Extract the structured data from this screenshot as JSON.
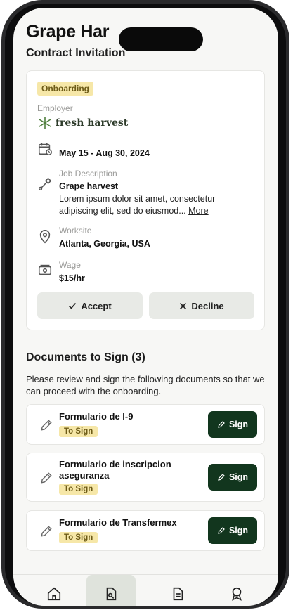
{
  "header": {
    "title": "Grape Har",
    "subtitle": "Contract Invitation"
  },
  "contract": {
    "status": "Onboarding",
    "employer_label": "Employer",
    "employer_name": "fresh harvest",
    "dates": "May 15 - Aug 30, 2024",
    "job_label": "Job Description",
    "job_title": "Grape harvest",
    "job_description": "Lorem ipsum dolor sit amet, consectetur adipiscing elit, sed do eiusmod...",
    "more_link": "More",
    "worksite_label": "Worksite",
    "worksite": "Atlanta, Georgia, USA",
    "wage_label": "Wage",
    "wage": "$15/hr",
    "accept_label": "Accept",
    "decline_label": "Decline"
  },
  "documents": {
    "title": "Documents to Sign (3)",
    "description": "Please review and sign the following documents so that we can proceed with the onboarding.",
    "items": [
      {
        "name": "Formulario de I-9",
        "status": "To Sign",
        "action": "Sign"
      },
      {
        "name": "Formulario de inscripcion aseguranza",
        "status": "To Sign",
        "action": "Sign"
      },
      {
        "name": "Formulario de Transfermex",
        "status": "To Sign",
        "action": "Sign"
      }
    ]
  },
  "icons": {
    "calendar": "calendar-icon",
    "tool": "tool-icon",
    "location": "location-pin-icon",
    "wage": "money-icon",
    "pencil": "pencil-icon",
    "home": "home-icon",
    "contracts": "contract-icon",
    "documents": "document-icon",
    "profile": "award-icon"
  },
  "colors": {
    "primary": "#12361e",
    "badge_bg": "#f6e7a8",
    "badge_text": "#6d5b17",
    "secondary_button": "#e8eae6"
  }
}
